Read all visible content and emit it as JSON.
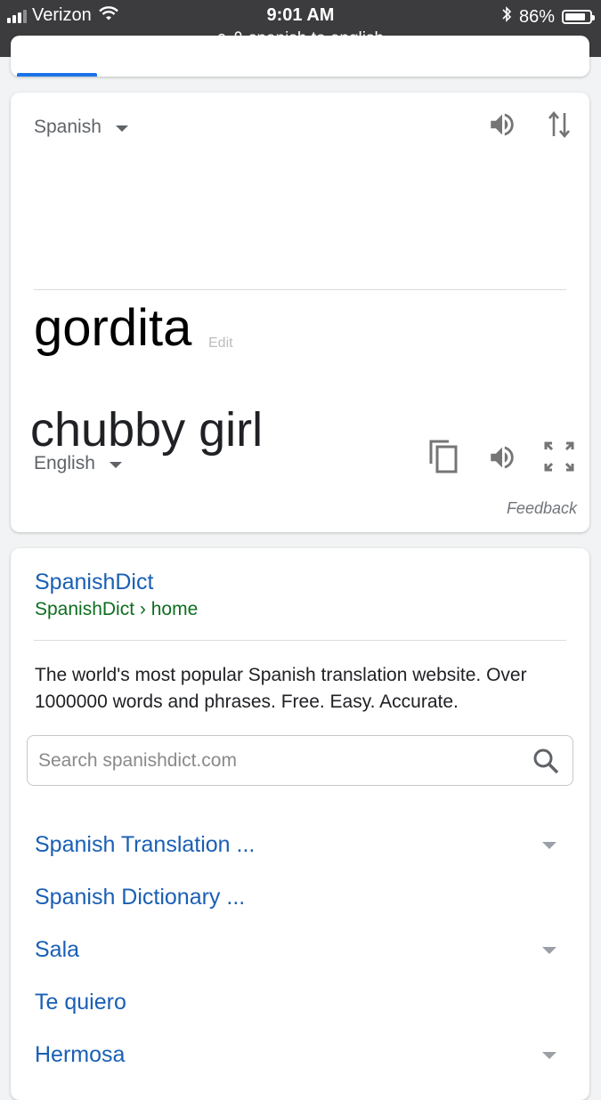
{
  "status_bar": {
    "carrier": "Verizon",
    "time": "9:01 AM",
    "battery": "86%",
    "battery_level": 0.86,
    "url": "spanish to english"
  },
  "translate": {
    "source_lang": "Spanish",
    "source_text": "gordita",
    "edit_label": "Edit",
    "target_text": "chubby girl",
    "target_lang": "English",
    "feedback": "Feedback"
  },
  "result": {
    "title": "SpanishDict",
    "breadcrumb": "SpanishDict › home",
    "description": "The world's most popular Spanish translation website. Over 1000000 words and phrases. Free. Easy. Accurate.",
    "search_placeholder": "Search spanishdict.com",
    "links": [
      {
        "label": "Spanish Translation ...",
        "expandable": true
      },
      {
        "label": "Spanish Dictionary ...",
        "expandable": false
      },
      {
        "label": "Sala",
        "expandable": true
      },
      {
        "label": "Te quiero",
        "expandable": false
      },
      {
        "label": "Hermosa",
        "expandable": true
      }
    ]
  },
  "colors": {
    "link_blue": "#1a5fb4",
    "url_green": "#0d6e1e",
    "accent_blue": "#1a73e8",
    "status_bar_bg": "#3c3c3e"
  },
  "icons": [
    "signal-icon",
    "wifi-icon",
    "bluetooth-icon",
    "battery-icon",
    "search-icon",
    "lock-icon",
    "speaker-icon",
    "swap-icon",
    "copy-icon",
    "fullscreen-icon",
    "chevron-down-icon"
  ]
}
